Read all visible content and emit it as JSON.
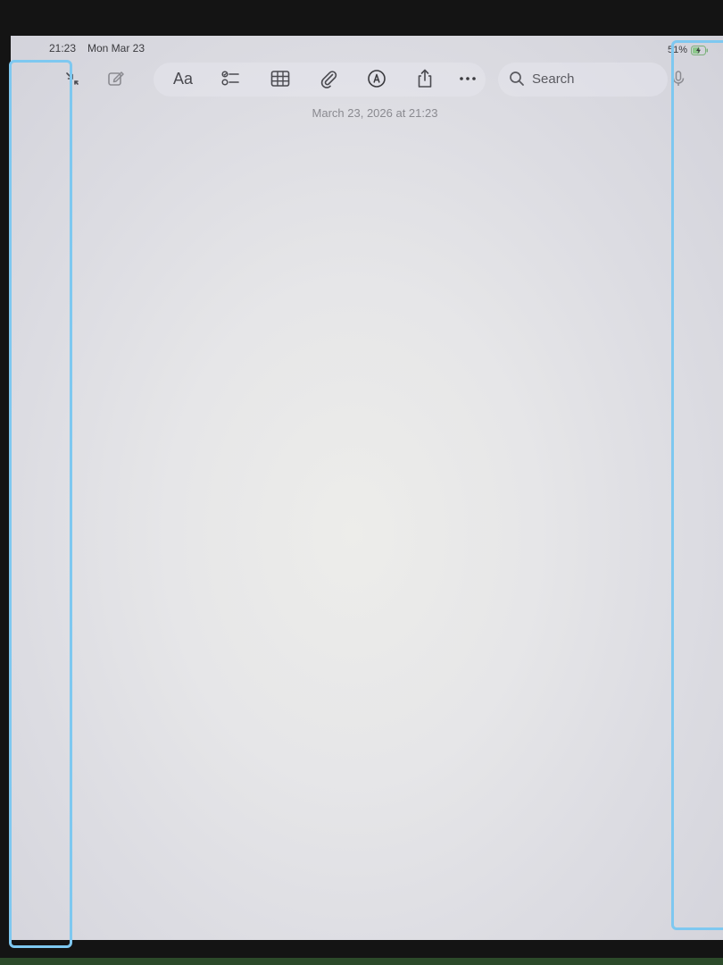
{
  "status_bar": {
    "time": "21:23",
    "date": "Mon Mar 23",
    "battery": "51%"
  },
  "toolbar": {
    "collapse_icon": "arrows-collapse-icon",
    "compose_icon": "compose-icon",
    "format_label": "Aa",
    "checklist_icon": "checklist-icon",
    "table_icon": "table-icon",
    "attachment_icon": "paperclip-icon",
    "markup_icon": "markup-pen-icon",
    "share_icon": "share-icon",
    "more_icon": "ellipsis-icon",
    "search_label": "Search",
    "dictation_icon": "microphone-icon"
  },
  "note": {
    "timestamp": "March 23, 2026 at 21:23"
  },
  "colors": {
    "highlight": "#7ec8f0"
  }
}
